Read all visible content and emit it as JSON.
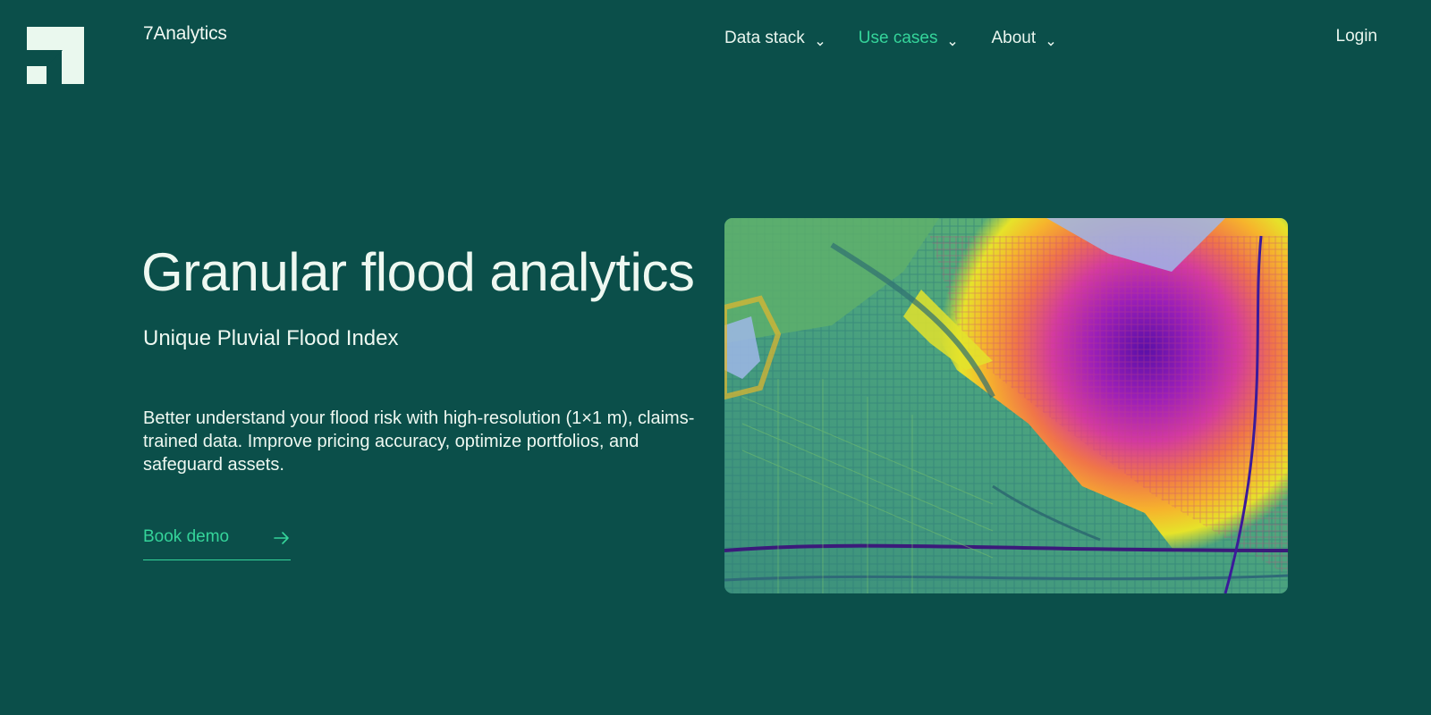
{
  "brand": {
    "name": "7Analytics",
    "logo_icon": "7analytics-logo-icon",
    "logo_color": "#eaf8ee"
  },
  "nav": {
    "items": [
      {
        "label": "Data stack",
        "icon": "chevron-down-icon",
        "active": false
      },
      {
        "label": "Use cases",
        "icon": "chevron-down-icon",
        "active": true
      },
      {
        "label": "About",
        "icon": "chevron-down-icon",
        "active": false
      }
    ],
    "login_label": "Login"
  },
  "hero": {
    "title": "Granular flood analytics",
    "subtitle": "Unique Pluvial Flood Index",
    "description": "Better understand your flood risk with high-resolution (1×1 m), claims-trained data. Improve pricing accuracy, optimize portfolios, and safeguard assets.",
    "cta_label": "Book demo",
    "cta_icon": "arrow-right-icon"
  },
  "image": {
    "subject": "flood-risk-heatmap-image"
  },
  "colors": {
    "background": "#0b4f4a",
    "accent": "#35d49a",
    "text": "#eef8f1"
  }
}
